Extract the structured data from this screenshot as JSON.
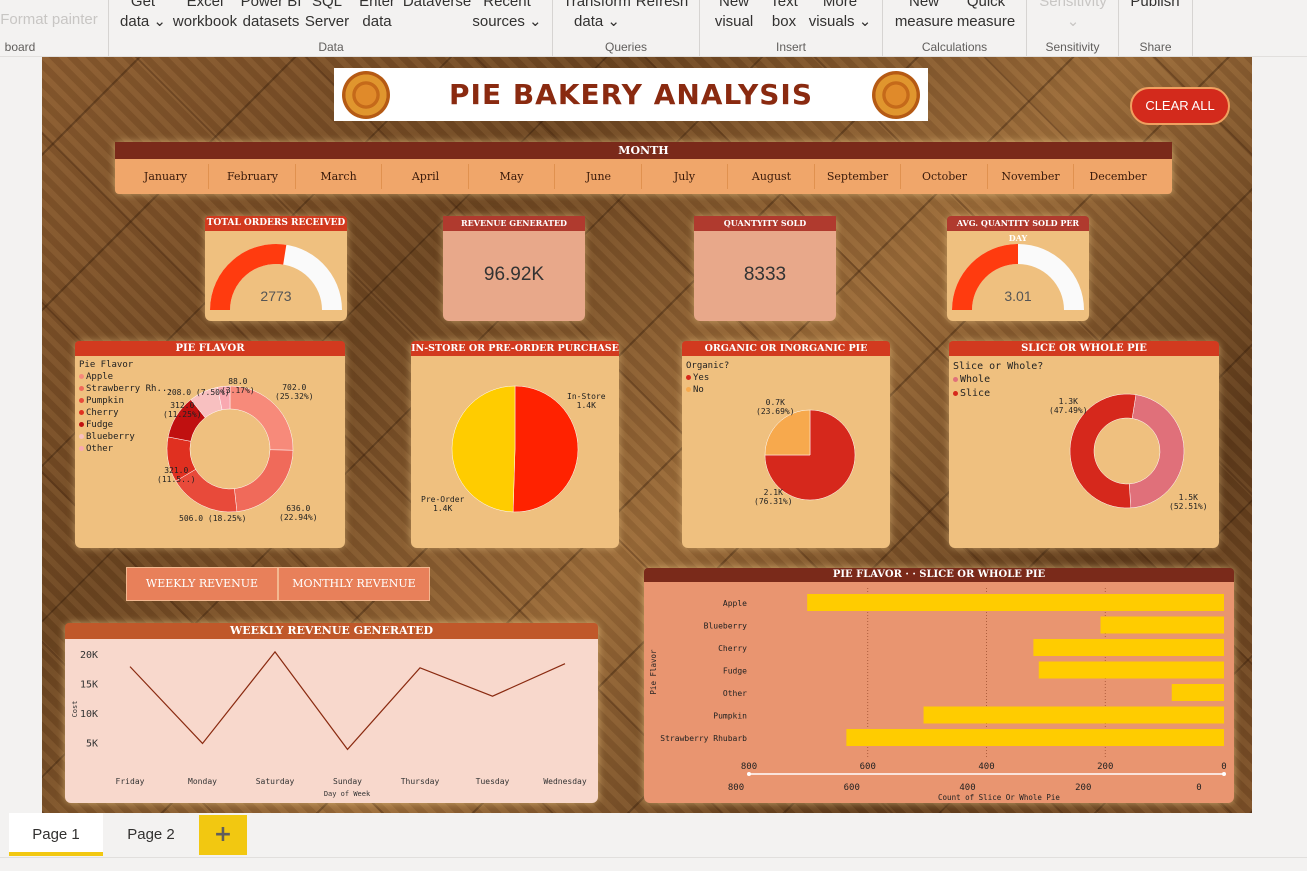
{
  "ribbon": {
    "items": [
      {
        "label": "Format painter"
      },
      {
        "label": "Get\ndata ⌄"
      },
      {
        "label": "Excel\nworkbook"
      },
      {
        "label": "Power BI\ndatasets"
      },
      {
        "label": "SQL\nServer"
      },
      {
        "label": "Enter\ndata"
      },
      {
        "label": "Dataverse"
      },
      {
        "label": "Recent\nsources ⌄"
      },
      {
        "label": "Transform\ndata ⌄"
      },
      {
        "label": "Refresh"
      },
      {
        "label": "New\nvisual"
      },
      {
        "label": "Text\nbox"
      },
      {
        "label": "More\nvisuals ⌄"
      },
      {
        "label": "New\nmeasure"
      },
      {
        "label": "Quick\nmeasure"
      },
      {
        "label": "Sensitivity\n⌄"
      },
      {
        "label": "Publish"
      }
    ],
    "groups": [
      "board",
      "Data",
      "Queries",
      "Insert",
      "Calculations",
      "Sensitivity",
      "Share"
    ]
  },
  "header": {
    "title": "PIE BAKERY ANALYSIS",
    "clear_label": "CLEAR ALL"
  },
  "month_slicer": {
    "title": "MONTH",
    "months": [
      "January",
      "February",
      "March",
      "April",
      "May",
      "June",
      "July",
      "August",
      "September",
      "October",
      "November",
      "December"
    ]
  },
  "kpis": {
    "total_orders": {
      "title": "TOTAL ORDERS RECEIVED",
      "value": "2773",
      "fill": 0.55
    },
    "revenue": {
      "title": "REVENUE GENERATED",
      "value": "96.92K"
    },
    "quantity": {
      "title": "QUANTYITY SOLD",
      "value": "8333"
    },
    "avg_qty": {
      "title": "AVG. QUANTITY SOLD PER DAY",
      "value": "3.01",
      "fill": 0.5
    }
  },
  "pie_flavor": {
    "title": "PIE FLAVOR",
    "legend_title": "Pie Flavor",
    "legend": [
      {
        "name": "Apple",
        "color": "#f78a7a"
      },
      {
        "name": "Strawberry Rh...",
        "color": "#f06a5a"
      },
      {
        "name": "Pumpkin",
        "color": "#e84a3a"
      },
      {
        "name": "Cherry",
        "color": "#e03020"
      },
      {
        "name": "Fudge",
        "color": "#c01010"
      },
      {
        "name": "Blueberry",
        "color": "#f8c0c0"
      },
      {
        "name": "Other",
        "color": "#f9a8b0"
      }
    ],
    "labels": [
      "702.0\n(25.32%)",
      "636.0\n(22.94%)",
      "506.0 (18.25%)",
      "321.0\n(11.5..)",
      "312.0\n(11.25%)",
      "208.0 (7.50%)",
      "88.0\n(3.17%)"
    ]
  },
  "purchase": {
    "title": "IN-STORE OR PRE-ORDER PURCHASE",
    "labels": [
      "In-Store\n1.4K",
      "Pre-Order\n1.4K"
    ]
  },
  "organic": {
    "title": "ORGANIC OR INORGANIC PIE",
    "legend_title": "Organic?",
    "legend": [
      {
        "name": "Yes",
        "color": "#d6281c"
      },
      {
        "name": "No",
        "color": "#f7a94d"
      }
    ],
    "labels": [
      "0.7K\n(23.69%)",
      "2.1K\n(76.31%)"
    ]
  },
  "slice": {
    "title": "SLICE OR WHOLE PIE",
    "legend_title": "Slice or Whole?",
    "legend": [
      {
        "name": "Whole",
        "color": "#e0707a"
      },
      {
        "name": "Slice",
        "color": "#d6281c"
      }
    ],
    "labels": [
      "1.3K\n(47.49%)",
      "1.5K\n(52.51%)"
    ]
  },
  "tabs": {
    "weekly": "WEEKLY REVENUE",
    "monthly": "MONTHLY REVENUE"
  },
  "weekly_chart": {
    "title": "WEEKLY REVENUE GENERATED",
    "xlabel": "Day of Week",
    "ylabel": "Cost"
  },
  "bar_chart": {
    "title": "PIE FLAVOR · · SLICE OR WHOLE PIE",
    "ylabel": "Pie Flavor",
    "xlabel": "Count of Slice Or Whole Pie"
  },
  "pages": {
    "page1": "Page 1",
    "page2": "Page 2",
    "add": "+"
  },
  "chart_data": [
    {
      "type": "pie",
      "title": "PIE FLAVOR",
      "categories": [
        "Apple",
        "Strawberry Rhubarb",
        "Pumpkin",
        "Cherry",
        "Fudge",
        "Blueberry",
        "Other"
      ],
      "values": [
        702,
        636,
        506,
        321,
        312,
        208,
        88
      ],
      "colors": [
        "#f78a7a",
        "#f06a5a",
        "#e84a3a",
        "#e03020",
        "#c01010",
        "#f8c0c0",
        "#f9a8b0"
      ]
    },
    {
      "type": "pie",
      "title": "IN-STORE OR PRE-ORDER PURCHASE",
      "categories": [
        "In-Store",
        "Pre-Order"
      ],
      "values": [
        1400,
        1373
      ],
      "colors": [
        "#ff2200",
        "#ffcc00"
      ]
    },
    {
      "type": "pie",
      "title": "ORGANIC OR INORGANIC PIE",
      "categories": [
        "Yes",
        "No"
      ],
      "values": [
        2100,
        700
      ],
      "percent": [
        76.31,
        23.69
      ],
      "colors": [
        "#d6281c",
        "#f7a94d"
      ]
    },
    {
      "type": "pie",
      "title": "SLICE OR WHOLE PIE",
      "categories": [
        "Whole",
        "Slice"
      ],
      "values": [
        1300,
        1500
      ],
      "percent": [
        47.49,
        52.51
      ],
      "colors": [
        "#e0707a",
        "#d6281c"
      ]
    },
    {
      "type": "line",
      "title": "WEEKLY REVENUE GENERATED",
      "x": [
        "Friday",
        "Monday",
        "Saturday",
        "Sunday",
        "Thursday",
        "Tuesday",
        "Wednesday"
      ],
      "series": [
        {
          "values": [
            18000,
            5000,
            20500,
            4000,
            17800,
            13000,
            18500
          ]
        }
      ],
      "xlabel": "Day of Week",
      "ylabel": "Cost",
      "yticks": [
        "5K",
        "10K",
        "15K",
        "20K"
      ],
      "ylim": [
        0,
        22000
      ]
    },
    {
      "type": "bar",
      "title": "PIE FLAVOR · · SLICE OR WHOLE PIE",
      "orientation": "horizontal",
      "categories": [
        "Apple",
        "Blueberry",
        "Cherry",
        "Fudge",
        "Other",
        "Pumpkin",
        "Strawberry Rhubarb"
      ],
      "values": [
        702,
        208,
        321,
        312,
        88,
        506,
        636
      ],
      "xlim": [
        0,
        800
      ],
      "xticks": [
        "800",
        "600",
        "400",
        "200",
        "0"
      ],
      "reversed_x": true,
      "color": "#ffcc00",
      "xlabel": "Count of Slice Or Whole Pie",
      "ylabel": "Pie Flavor"
    }
  ]
}
